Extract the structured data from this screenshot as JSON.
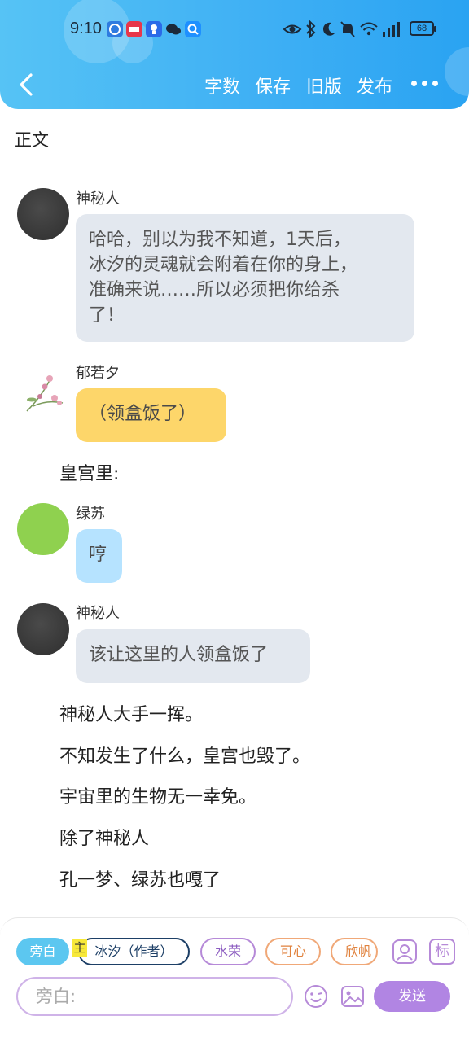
{
  "status_bar": {
    "time": "9:10",
    "battery": "68",
    "app_icons": [
      "browser-icon",
      "news-app-icon",
      "bulb-app-icon",
      "wechat-icon",
      "search-app-icon"
    ],
    "right_icons": [
      "eye-icon",
      "bluetooth-icon",
      "moon-icon",
      "bell-off-icon",
      "wifi-icon",
      "signal-icon"
    ]
  },
  "header": {
    "back_icon": "chevron-left-icon",
    "actions": [
      "字数",
      "保存",
      "旧版",
      "发布"
    ],
    "more_icon": "more-dots-icon",
    "colors": {
      "gradient_start": "#56c3f5",
      "gradient_end": "#2aa3f2"
    }
  },
  "section_title": "正文",
  "messages": [
    {
      "sender": "神秘人",
      "text": "哈哈，别以为我不知道，1天后，冰汐的灵魂就会附着在你的身上，准确来说……所以必须把你给杀了！",
      "lines": [
        "哈哈，别以为我不知道，1天后，",
        "冰汐的灵魂就会附着在你的身上，",
        "准确来说……所以必须把你给杀",
        "了！"
      ],
      "bubble_color": "#e3e8ef"
    },
    {
      "sender": "郁若夕",
      "text": "（领盒饭了）",
      "bubble_color": "#fdd66a"
    },
    {
      "sender": "绿苏",
      "text": "哼",
      "bubble_color": "#b6e3ff"
    },
    {
      "sender": "神秘人",
      "text": "该让这里的人领盒饭了",
      "bubble_color": "#e3e8ef"
    }
  ],
  "narrations": [
    "皇宫里:",
    "神秘人大手一挥。",
    "不知发生了什么，皇宫也毁了。",
    "宇宙里的生物无一幸免。",
    "除了神秘人",
    "孔一梦、绿苏也嘎了"
  ],
  "role_chips": {
    "narrator": "旁白",
    "main_badge": "主",
    "main": "冰汐（作者）",
    "others": [
      "水荣",
      "可心",
      "欣帆"
    ]
  },
  "tools": {
    "avatar_icon": "user-card-icon",
    "tag_label": "标"
  },
  "composer": {
    "placeholder": "旁白:",
    "emoji_icon": "emoji-icon",
    "image_icon": "image-icon",
    "send_label": "发送",
    "accent": "#b185e3"
  }
}
